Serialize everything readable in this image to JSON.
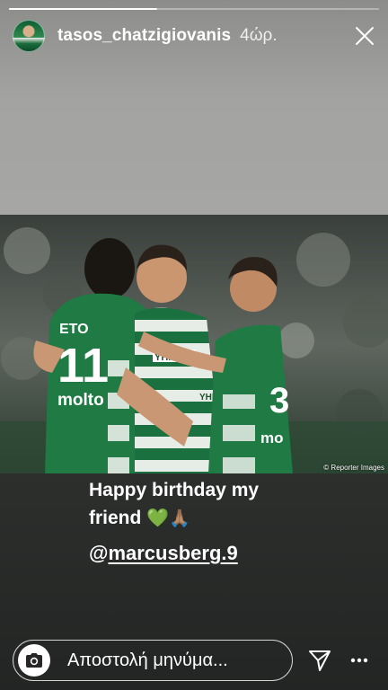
{
  "story": {
    "progress_fraction": 0.4,
    "user": {
      "username": "tasos_chatzigiovanis",
      "time_ago": "4ώρ."
    },
    "photo": {
      "credit": "© Reporter Images",
      "jersey_texts": [
        "ETO",
        "11",
        "molto",
        "ΥΗΜΑ",
        "ΥΗΜΑ",
        "3",
        "mo"
      ]
    },
    "caption": {
      "line1": "Happy birthday my",
      "line2": "friend",
      "heart_emoji": "💚",
      "hands_emoji": "🙏🏽",
      "at": "@",
      "mention": "marcusberg.9"
    },
    "reply": {
      "placeholder": "Αποστολή μηνύμα..."
    },
    "icons": {
      "close": "close-icon",
      "camera": "camera-icon",
      "send": "send-icon",
      "more": "more-icon"
    },
    "colors": {
      "kit_green": "#1f7a43",
      "kit_white": "#eef2ee",
      "accent_text": "#ffffff"
    }
  }
}
